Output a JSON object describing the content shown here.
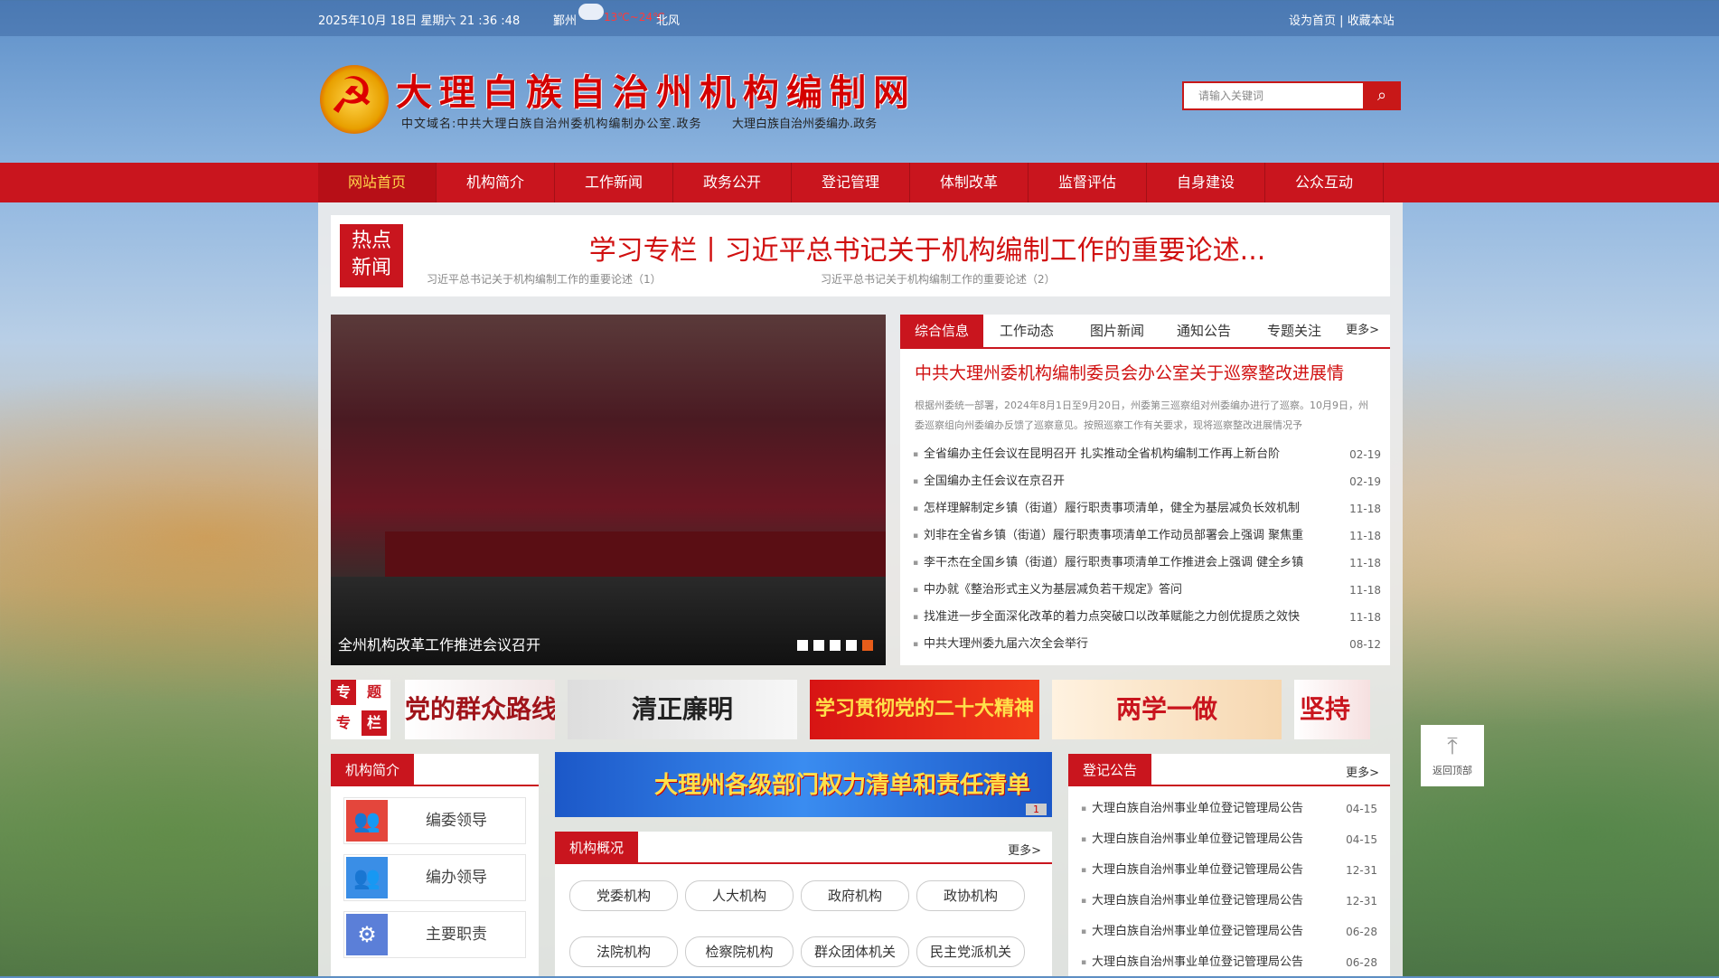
{
  "topbar": {
    "date": "2025年10月 18日 星期六 21  :36  :48",
    "city": "鄞州",
    "temp": "13℃~24℃",
    "wind": "北风",
    "set_home": "设为首页",
    "separator": "|",
    "favorite": "收藏本站"
  },
  "header": {
    "title": "大理白族自治州机构编制网",
    "subtitle_left": "中文域名:中共大理白族自治州委机构编制办公室.政务",
    "subtitle_right": "大理白族自治州委编办.政务",
    "search_placeholder": "请输入关键词"
  },
  "nav": [
    "网站首页",
    "机构简介",
    "工作新闻",
    "政务公开",
    "登记管理",
    "体制改革",
    "监督评估",
    "自身建设",
    "公众互动"
  ],
  "hot": {
    "badge_line1": "热点",
    "badge_line2": "新闻",
    "title": "学习专栏丨习近平总书记关于机构编制工作的重要论述...",
    "sub1": "习近平总书记关于机构编制工作的重要论述（1）",
    "sub2": "习近平总书记关于机构编制工作的重要论述（2）"
  },
  "slide": {
    "caption": "全州机构改革工作推进会议召开",
    "dots": 5,
    "active_dot": 5
  },
  "tabs": {
    "items": [
      "综合信息",
      "工作动态",
      "图片新闻",
      "通知公告",
      "专题关注"
    ],
    "more": "更多>",
    "headline": "中共大理州委机构编制委员会办公室关于巡察整改进展情",
    "summary": "根据州委统一部署，2024年8月1日至9月20日，州委第三巡察组对州委编办进行了巡察。10月9日，州委巡察组向州委编办反馈了巡察意见。按照巡察工作有关要求，现将巡察整改进展情况予",
    "news": [
      {
        "title": "全省编办主任会议在昆明召开 扎实推动全省机构编制工作再上新台阶",
        "date": "02-19"
      },
      {
        "title": "全国编办主任会议在京召开",
        "date": "02-19"
      },
      {
        "title": "怎样理解制定乡镇（街道）履行职责事项清单，健全为基层减负长效机制",
        "date": "11-18"
      },
      {
        "title": "刘非在全省乡镇（街道）履行职责事项清单工作动员部署会上强调 聚焦重",
        "date": "11-18"
      },
      {
        "title": "李干杰在全国乡镇（街道）履行职责事项清单工作推进会上强调 健全乡镇",
        "date": "11-18"
      },
      {
        "title": "中办就《整治形式主义为基层减负若干规定》答问",
        "date": "11-18"
      },
      {
        "title": "找准进一步全面深化改革的着力点突破口以改革赋能之力创优提质之效快",
        "date": "11-18"
      },
      {
        "title": "中共大理州委九届六次全会举行",
        "date": "08-12"
      }
    ]
  },
  "special": {
    "label": [
      "专",
      "题",
      "专",
      "栏"
    ],
    "banners": [
      "党的群众路线",
      "清正廉明",
      "学习贯彻党的二十大精神",
      "两学一做",
      "坚持"
    ]
  },
  "org": {
    "title": "机构简介",
    "items": [
      "编委领导",
      "编办领导",
      "主要职责"
    ]
  },
  "power": {
    "text": "大理州各级部门权力清单和责任清单",
    "page": "1"
  },
  "overview": {
    "title": "机构概况",
    "more": "更多>",
    "pills": [
      "党委机构",
      "人大机构",
      "政府机构",
      "政协机构",
      "法院机构",
      "检察院机构",
      "群众团体机关",
      "民主党派机关"
    ]
  },
  "notice": {
    "title": "登记公告",
    "more": "更多>",
    "items": [
      {
        "title": "大理白族自治州事业单位登记管理局公告",
        "date": "04-15"
      },
      {
        "title": "大理白族自治州事业单位登记管理局公告",
        "date": "04-15"
      },
      {
        "title": "大理白族自治州事业单位登记管理局公告",
        "date": "12-31"
      },
      {
        "title": "大理白族自治州事业单位登记管理局公告",
        "date": "12-31"
      },
      {
        "title": "大理白族自治州事业单位登记管理局公告",
        "date": "06-28"
      },
      {
        "title": "大理白族自治州事业单位登记管理局公告",
        "date": "06-28"
      }
    ]
  },
  "backtop": {
    "label": "返回顶部"
  },
  "colors": {
    "brand_red": "#c9151e",
    "headline_red": "#d01010",
    "active_dot": "#e85d1a"
  }
}
